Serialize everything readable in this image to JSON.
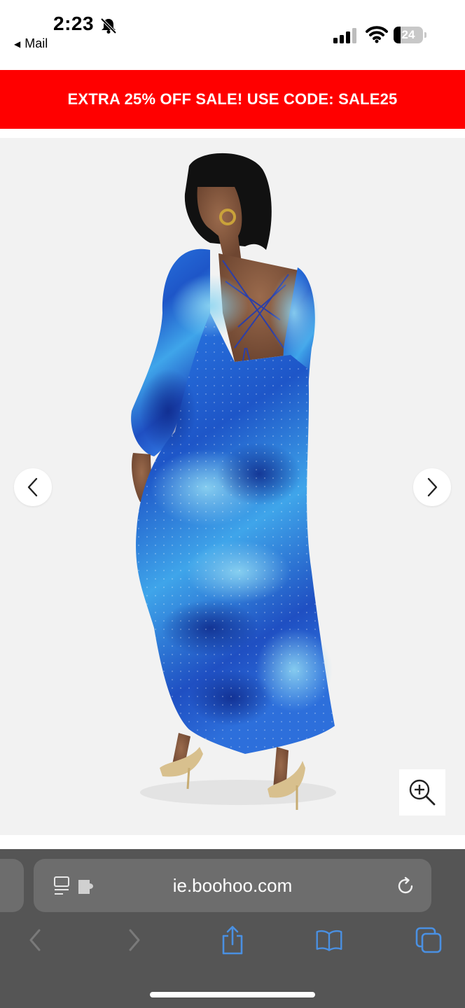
{
  "status_bar": {
    "time": "2:23",
    "back_label": "Mail",
    "battery": "24"
  },
  "promo": {
    "text": "EXTRA 25% OFF SALE! USE CODE: SALE25",
    "color": "#ff0000"
  },
  "gallery": {
    "image_alt": "Model wearing blue printed chiffon maxi dress with open lace-up back",
    "prev_icon": "chevron-left-icon",
    "next_icon": "chevron-right-icon",
    "zoom_icon": "zoom-in-icon"
  },
  "browser": {
    "url": "ie.boohoo.com",
    "toolbar": [
      "back-icon",
      "forward-icon",
      "share-icon",
      "bookmarks-icon",
      "tabs-icon"
    ],
    "accent": "#4a90e2"
  }
}
